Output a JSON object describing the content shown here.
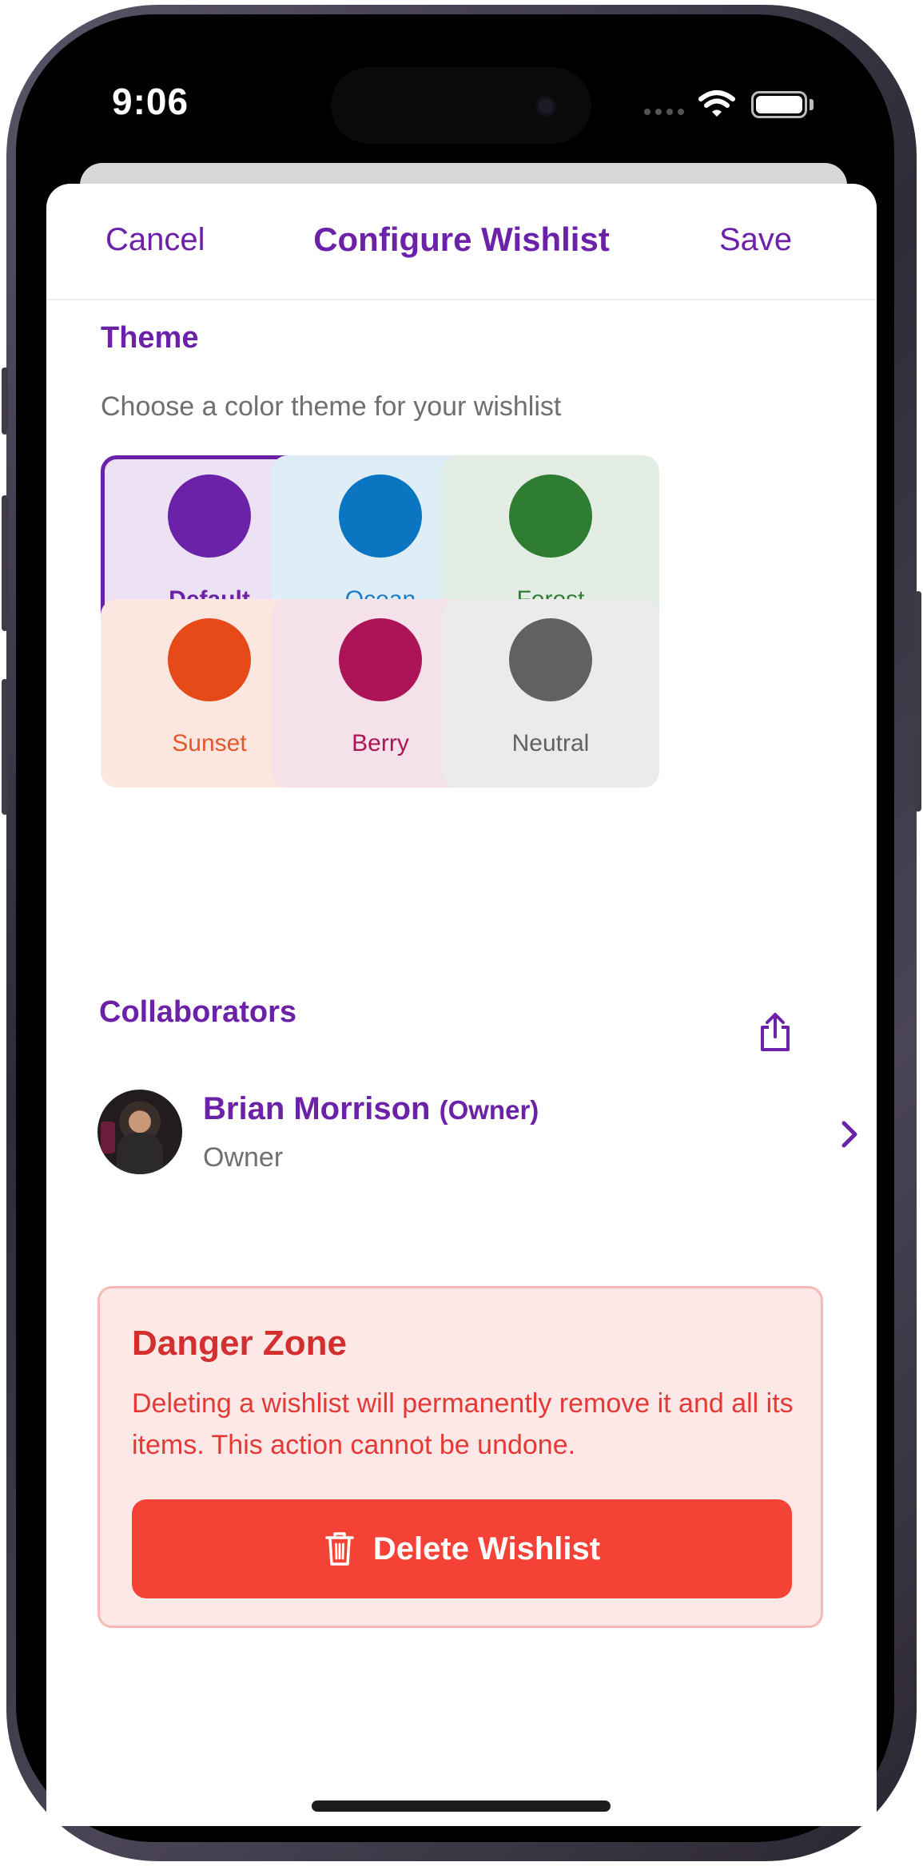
{
  "status_bar": {
    "time": "9:06"
  },
  "nav": {
    "cancel_label": "Cancel",
    "title": "Configure Wishlist",
    "save_label": "Save"
  },
  "theme": {
    "title": "Theme",
    "subtitle": "Choose a color theme for your wishlist",
    "selected": "Default",
    "options": [
      {
        "label": "Default",
        "color": "#6b21a8",
        "background": "#ede2f4",
        "text_color": "#6b21a8"
      },
      {
        "label": "Ocean",
        "color": "#0a76c2",
        "background": "#dfedf7",
        "text_color": "#1a7cc4"
      },
      {
        "label": "Forest",
        "color": "#2e7d32",
        "background": "#e4ede4",
        "text_color": "#2e7d32"
      },
      {
        "label": "Sunset",
        "color": "#e64a19",
        "background": "#fbe7df",
        "text_color": "#e8572a"
      },
      {
        "label": "Berry",
        "color": "#ad1457",
        "background": "#f4e1ea",
        "text_color": "#ad1457"
      },
      {
        "label": "Neutral",
        "color": "#616161",
        "background": "#ebebeb",
        "text_color": "#616161"
      }
    ]
  },
  "collaborators": {
    "title": "Collaborators",
    "share_icon": "share-icon",
    "items": [
      {
        "name": "Brian Morrison",
        "tag": "(Owner)",
        "role": "Owner"
      }
    ]
  },
  "danger_zone": {
    "title": "Danger Zone",
    "description": "Deleting a wishlist will permanently remove it and all its items. This action cannot be undone.",
    "delete_label": "Delete Wishlist",
    "delete_icon": "trash-icon"
  },
  "colors": {
    "accent": "#6b21a8",
    "danger": "#f44336",
    "danger_text": "#e53935"
  }
}
